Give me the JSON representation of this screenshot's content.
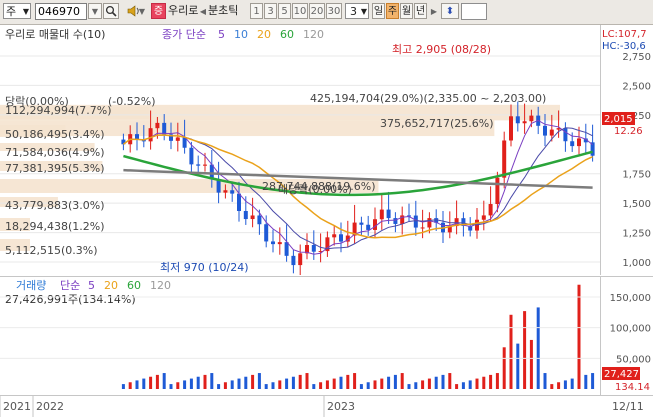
{
  "toolbar": {
    "market": "주",
    "code": "046970",
    "company": "우리로",
    "jeung": "증",
    "tick_label": "분초틱",
    "numbers": [
      "1",
      "3",
      "5",
      "10",
      "20",
      "30"
    ],
    "selected_num": "3",
    "periods": [
      "일",
      "주",
      "월",
      "년"
    ],
    "active_period": "주"
  },
  "colors": {
    "up": "#e0201b",
    "down": "#1e5ad6",
    "ma5": "#7b3fc2",
    "ma10": "#4a4aa8",
    "ma20": "#eaa21b",
    "ma60": "#2aa43a",
    "ma120": "#7c7c7c"
  },
  "price": {
    "title": "우리로 매물대 수(10)",
    "ma_label": "종가 단순",
    "ma_periods": [
      "5",
      "10",
      "20",
      "60",
      "120"
    ],
    "lc": "LC:107,7",
    "hc": "HC:-30,6",
    "current_price": "2,015",
    "current_pct": "12.26",
    "ticks": [
      {
        "label": "2,750",
        "value": 2750
      },
      {
        "label": "2,500",
        "value": 2500
      },
      {
        "label": "2,250",
        "value": 2250
      },
      {
        "label": "1,750",
        "value": 1750
      },
      {
        "label": "1,500",
        "value": 1500
      },
      {
        "label": "1,250",
        "value": 1250
      },
      {
        "label": "1,000",
        "value": 1000
      }
    ],
    "high_label": "최고 2,905 (08/28)",
    "low_label": "최저 970 (10/24)",
    "high_value": 2905,
    "low_value": 970,
    "profile": [
      {
        "text": "425,194,704(29.0%)(2,335.00 ~ 2,203.00)",
        "value": 425194704,
        "pct": 29.0,
        "low": 2203,
        "high": 2335
      },
      {
        "text": "375,652,717(25.6%)",
        "value": 375652717,
        "pct": 25.6,
        "low": 2070,
        "high": 2203
      },
      {
        "text": "112,294,994(7.7%)",
        "value": 112294994,
        "pct": 7.7
      },
      {
        "text": "50,186,495(3.4%)",
        "value": 50186495,
        "pct": 3.4
      },
      {
        "text": "71,584,036(4.9%)",
        "value": 71584036,
        "pct": 4.9
      },
      {
        "text": "77,381,395(5.3%)",
        "value": 77381395,
        "pct": 5.3
      },
      {
        "text": "287,744,888(19.6%)",
        "value": 287744888,
        "pct": 19.6
      },
      {
        "text": "43,779,883(3.0%)",
        "value": 43779883,
        "pct": 3.0
      },
      {
        "text": "18,294,438(1.2%)",
        "value": 18294438,
        "pct": 1.2
      },
      {
        "text": "5,112,515(0.3%)",
        "value": 5112515,
        "pct": 0.3
      }
    ],
    "annotations": [
      "당락(0.00%)",
      "(-0.52%)",
      "배당락(0.00%)"
    ]
  },
  "volume": {
    "title": "거래량",
    "ma_label": "단순",
    "ma_periods": [
      "5",
      "20",
      "60",
      "120"
    ],
    "current": "27,426,991주(134.14%)",
    "ticks": [
      {
        "label": "150,000",
        "value": 150000
      },
      {
        "label": "100,000",
        "value": 100000
      },
      {
        "label": "50,000",
        "value": 50000
      }
    ],
    "current_box": "27,427",
    "current_pct": "134.14"
  },
  "xaxis": {
    "labels": [
      {
        "text": "2021",
        "pos": 0.0
      },
      {
        "text": "2022",
        "pos": 0.055
      },
      {
        "text": "2023",
        "pos": 0.54
      }
    ],
    "right_label": "12/11"
  }
}
